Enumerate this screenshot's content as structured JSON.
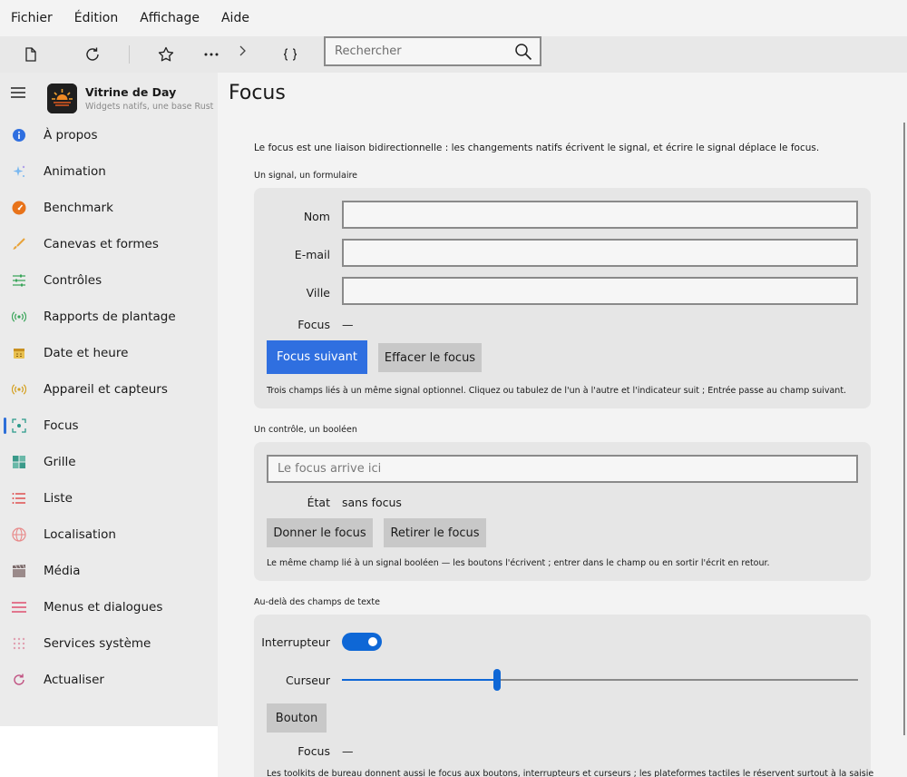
{
  "menubar": {
    "items": [
      "Fichier",
      "Édition",
      "Affichage",
      "Aide"
    ]
  },
  "toolbar": {
    "search_placeholder": "Rechercher",
    "icons": [
      "page-icon",
      "refresh-icon",
      "star-icon",
      "more-icon",
      "chevron-right-icon",
      "braces-icon",
      "search-icon"
    ]
  },
  "sidebar": {
    "brand_title": "Vitrine de Day",
    "brand_subtitle": "Widgets natifs, une base Rust",
    "items": [
      {
        "label": "À propos",
        "icon": "info-icon",
        "color": "#2f6fe0"
      },
      {
        "label": "Animation",
        "icon": "sparkle-icon",
        "color": "#5aa8e8"
      },
      {
        "label": "Benchmark",
        "icon": "gauge-icon",
        "color": "#e8731a"
      },
      {
        "label": "Canevas et formes",
        "icon": "brush-icon",
        "color": "#e8a33a"
      },
      {
        "label": "Contrôles",
        "icon": "sliders-icon",
        "color": "#3aa55a"
      },
      {
        "label": "Rapports de plantage",
        "icon": "broadcast-icon",
        "color": "#3aa55a"
      },
      {
        "label": "Date et heure",
        "icon": "calendar-icon",
        "color": "#d4a020"
      },
      {
        "label": "Appareil et capteurs",
        "icon": "sensor-icon",
        "color": "#d4a020"
      },
      {
        "label": "Focus",
        "icon": "focus-icon",
        "color": "#2a9a8a"
      },
      {
        "label": "Grille",
        "icon": "grid-icon",
        "color": "#3a9a8a"
      },
      {
        "label": "Liste",
        "icon": "list-icon",
        "color": "#e05050"
      },
      {
        "label": "Localisation",
        "icon": "globe-icon",
        "color": "#e88a8a"
      },
      {
        "label": "Média",
        "icon": "clapper-icon",
        "color": "#8a7a7a"
      },
      {
        "label": "Menus et dialogues",
        "icon": "menu-lines-icon",
        "color": "#e05070"
      },
      {
        "label": "Services système",
        "icon": "dots-grid-icon",
        "color": "#e0a0b0"
      },
      {
        "label": "Actualiser",
        "icon": "refresh-circle-icon",
        "color": "#c05080"
      }
    ],
    "active": "Focus"
  },
  "main": {
    "title": "Focus",
    "intro": "Le focus est une liaison bidirectionnelle : les changements natifs écrivent le signal, et écrire le signal déplace le focus.",
    "section1": {
      "label": "Un signal, un formulaire",
      "fields": [
        "Nom",
        "E-mail",
        "Ville"
      ],
      "focus_label": "Focus",
      "focus_value": "—",
      "btn_next": "Focus suivant",
      "btn_clear": "Effacer le focus",
      "hint": "Trois champs liés à un même signal optionnel. Cliquez ou tabulez de l'un à l'autre et l'indicateur suit ; Entrée passe au champ suivant."
    },
    "section2": {
      "label": "Un contrôle, un booléen",
      "placeholder": "Le focus arrive ici",
      "state_label": "État",
      "state_value": "sans focus",
      "btn_give": "Donner le focus",
      "btn_remove": "Retirer le focus",
      "hint": "Le même champ lié à un signal booléen — les boutons l'écrivent ; entrer dans le champ ou en sortir l'écrit en retour."
    },
    "section3": {
      "label": "Au-delà des champs de texte",
      "toggle_label": "Interrupteur",
      "toggle_on": true,
      "slider_label": "Curseur",
      "slider_value": 0.3,
      "button_label": "Bouton",
      "focus_label": "Focus",
      "focus_value": "—",
      "hint": "Les toolkits de bureau donnent aussi le focus aux boutons, interrupteurs et curseurs ; les plateformes tactiles le réservent surtout à la saisie"
    }
  }
}
